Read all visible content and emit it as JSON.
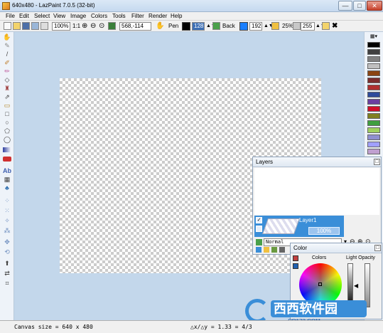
{
  "window": {
    "title": "640x480 - LazPaint 7.0.5 (32-bit)",
    "minimize": "—",
    "maximize": "□",
    "close": "✕"
  },
  "menu": [
    "File",
    "Edit",
    "Select",
    "View",
    "Image",
    "Colors",
    "Tools",
    "Filter",
    "Render",
    "Help"
  ],
  "toolbar": {
    "zoom": "100%",
    "zoom_ratio": "1:1",
    "coords": "568,-114",
    "pen_label": "Pen",
    "back_label": "Back",
    "pen_opacity": "128",
    "back_opacity": "192",
    "tolerance": "25%",
    "alpha": "255",
    "pen_color": "#000000",
    "back_color": "#1a7fff"
  },
  "palette_colors": [
    "#000000",
    "#404040",
    "#808080",
    "#c0c0c0",
    "#8b4513",
    "#7b2e2e",
    "#b03030",
    "#2e4b9b",
    "#6b3fa0",
    "#d0102a",
    "#808020",
    "#3f9f3f",
    "#9fd05f",
    "#8f8fd0",
    "#a0a0ff",
    "#c0a0d0",
    "#ff7f50",
    "#f08080",
    "#ffa0c0",
    "#d070d0"
  ],
  "layers_panel": {
    "title": "Layers",
    "layer_name": "Layer1",
    "opacity": "100%",
    "blend_mode": "Normal"
  },
  "color_panel": {
    "title": "Color",
    "colors_label": "Colors",
    "light_opacity_label": "Light Opacity"
  },
  "status": {
    "canvas_size": "Canvas size = 640 x 480",
    "ratio": "△x/△y = 1.33 = 4/3"
  },
  "watermark": {
    "text": "西西软件园",
    "site": "CR173.COM"
  }
}
